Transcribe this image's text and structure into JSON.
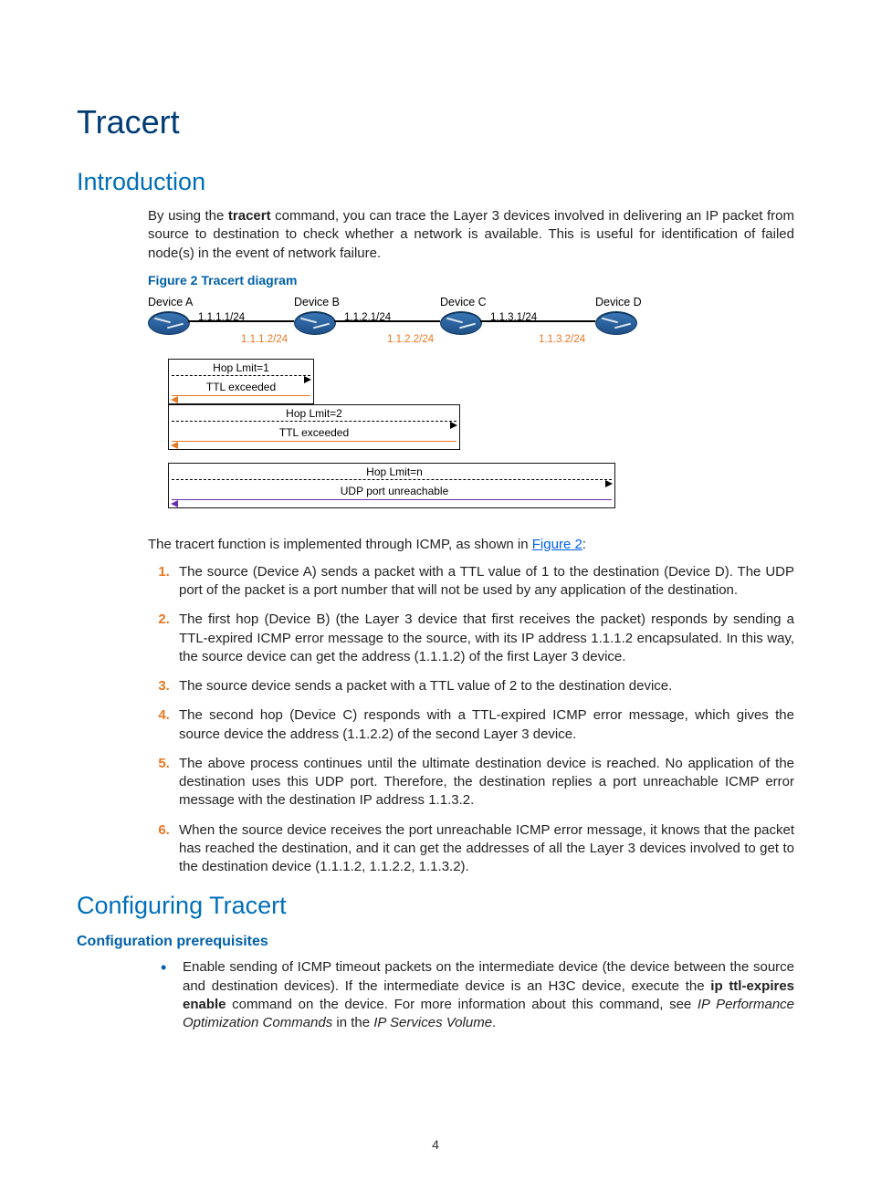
{
  "title": "Tracert",
  "intro_heading": "Introduction",
  "intro_para_before": "By using the ",
  "intro_bold": "tracert",
  "intro_para_after": " command, you can trace the Layer 3 devices involved in delivering an IP packet from source to destination to check whether a network is available. This is useful for identification of failed node(s) in the event of network failure.",
  "figcap": "Figure 2 Tracert diagram",
  "devices": {
    "a": "Device A",
    "b": "Device B",
    "c": "Device C",
    "d": "Device D"
  },
  "ips": {
    "ab_top": "1.1.1.1/24",
    "ab_bot": "1.1.1.2/24",
    "bc_top": "1.1.2.1/24",
    "bc_bot": "1.1.2.2/24",
    "cd_top": "1.1.3.1/24",
    "cd_bot": "1.1.3.2/24"
  },
  "msgs": {
    "hop1": "Hop Lmit=1",
    "ttl1": "TTL exceeded",
    "hop2": "Hop Lmit=2",
    "ttl2": "TTL exceeded",
    "hopn": "Hop Lmit=n",
    "udp": "UDP port unreachable"
  },
  "implline_before": "The tracert function is implemented through ICMP, as shown in ",
  "implline_link": "Figure 2",
  "implline_after": ":",
  "steps": [
    "The source (Device A) sends a packet with a TTL value of 1 to the destination (Device D). The UDP port of the packet is a port number that will not be used by any application of the destination.",
    "The first hop (Device B) (the Layer 3 device that first receives the packet) responds by sending a TTL-expired ICMP error message to the source, with its IP address 1.1.1.2 encapsulated. In this way, the source device can get the address (1.1.1.2) of the first Layer 3 device.",
    "The source device sends a packet with a TTL value of 2 to the destination device.",
    "The second hop (Device C) responds with a TTL-expired ICMP error message, which gives the source device the address (1.1.2.2) of the second Layer 3 device.",
    "The above process continues until the ultimate destination device is reached. No application of the destination uses this UDP port. Therefore, the destination replies a port unreachable ICMP error message with the destination IP address 1.1.3.2.",
    "When the source device receives the port unreachable ICMP error message, it knows that the packet has reached the destination, and it can get the addresses of all the Layer 3 devices involved to get to the destination device (1.1.1.2, 1.1.2.2, 1.1.3.2)."
  ],
  "config_heading": "Configuring Tracert",
  "config_sub": "Configuration prerequisites",
  "bullet1_a": "Enable sending of ICMP timeout packets on the intermediate device (the device between the source and destination devices). If the intermediate device is an H3C device, execute the ",
  "bullet1_b": "ip ttl-expires enable",
  "bullet1_c": " command on the device. For more information about this command, see ",
  "bullet1_d": "IP Performance Optimization Commands",
  "bullet1_e": " in the ",
  "bullet1_f": "IP Services Volume",
  "bullet1_g": ".",
  "pagenum": "4"
}
